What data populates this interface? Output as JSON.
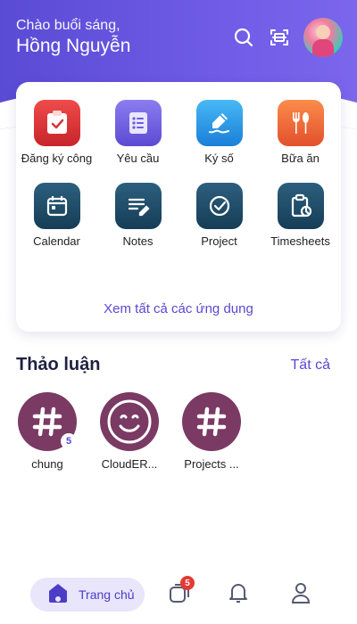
{
  "header": {
    "greeting": "Chào buổi sáng,",
    "user_name": "Hồng Nguyễn",
    "icons": [
      "search-icon",
      "scan-icon",
      "avatar"
    ]
  },
  "apps": {
    "items": [
      {
        "label": "Đăng ký công",
        "icon": "calendar-check-icon",
        "color": "#d9363b"
      },
      {
        "label": "Yêu cầu",
        "icon": "request-list-icon",
        "color": "#6c5ce0"
      },
      {
        "label": "Ký số",
        "icon": "pen-sign-icon",
        "color": "#2793e6"
      },
      {
        "label": "Bữa ăn",
        "icon": "fork-spoon-icon",
        "color": "#f06a36"
      },
      {
        "label": "Calendar",
        "icon": "calendar-icon",
        "color": "#1e4a66"
      },
      {
        "label": "Notes",
        "icon": "notes-icon",
        "color": "#1e4a66"
      },
      {
        "label": "Project",
        "icon": "project-check-icon",
        "color": "#1e4a66"
      },
      {
        "label": "Timesheets",
        "icon": "timesheet-icon",
        "color": "#1e4a66"
      }
    ],
    "see_all": "Xem tất cả các ứng dụng"
  },
  "discussion": {
    "title": "Thảo luận",
    "see_all": "Tất cả",
    "channels": [
      {
        "name": "chung",
        "icon": "hashtag-icon",
        "badge": "5"
      },
      {
        "name": "CloudER...",
        "icon": "smile-icon",
        "badge": ""
      },
      {
        "name": "Projects ...",
        "icon": "hashtag-icon",
        "badge": ""
      }
    ]
  },
  "bottom_nav": {
    "home_label": "Trang chủ",
    "chat_badge": "5",
    "icons": [
      "home-icon",
      "chat-icon",
      "bell-icon",
      "profile-icon"
    ]
  },
  "colors": {
    "brand": "#5a48d2",
    "header": "#6f5be6",
    "channel_avatar": "#7a3a63"
  }
}
